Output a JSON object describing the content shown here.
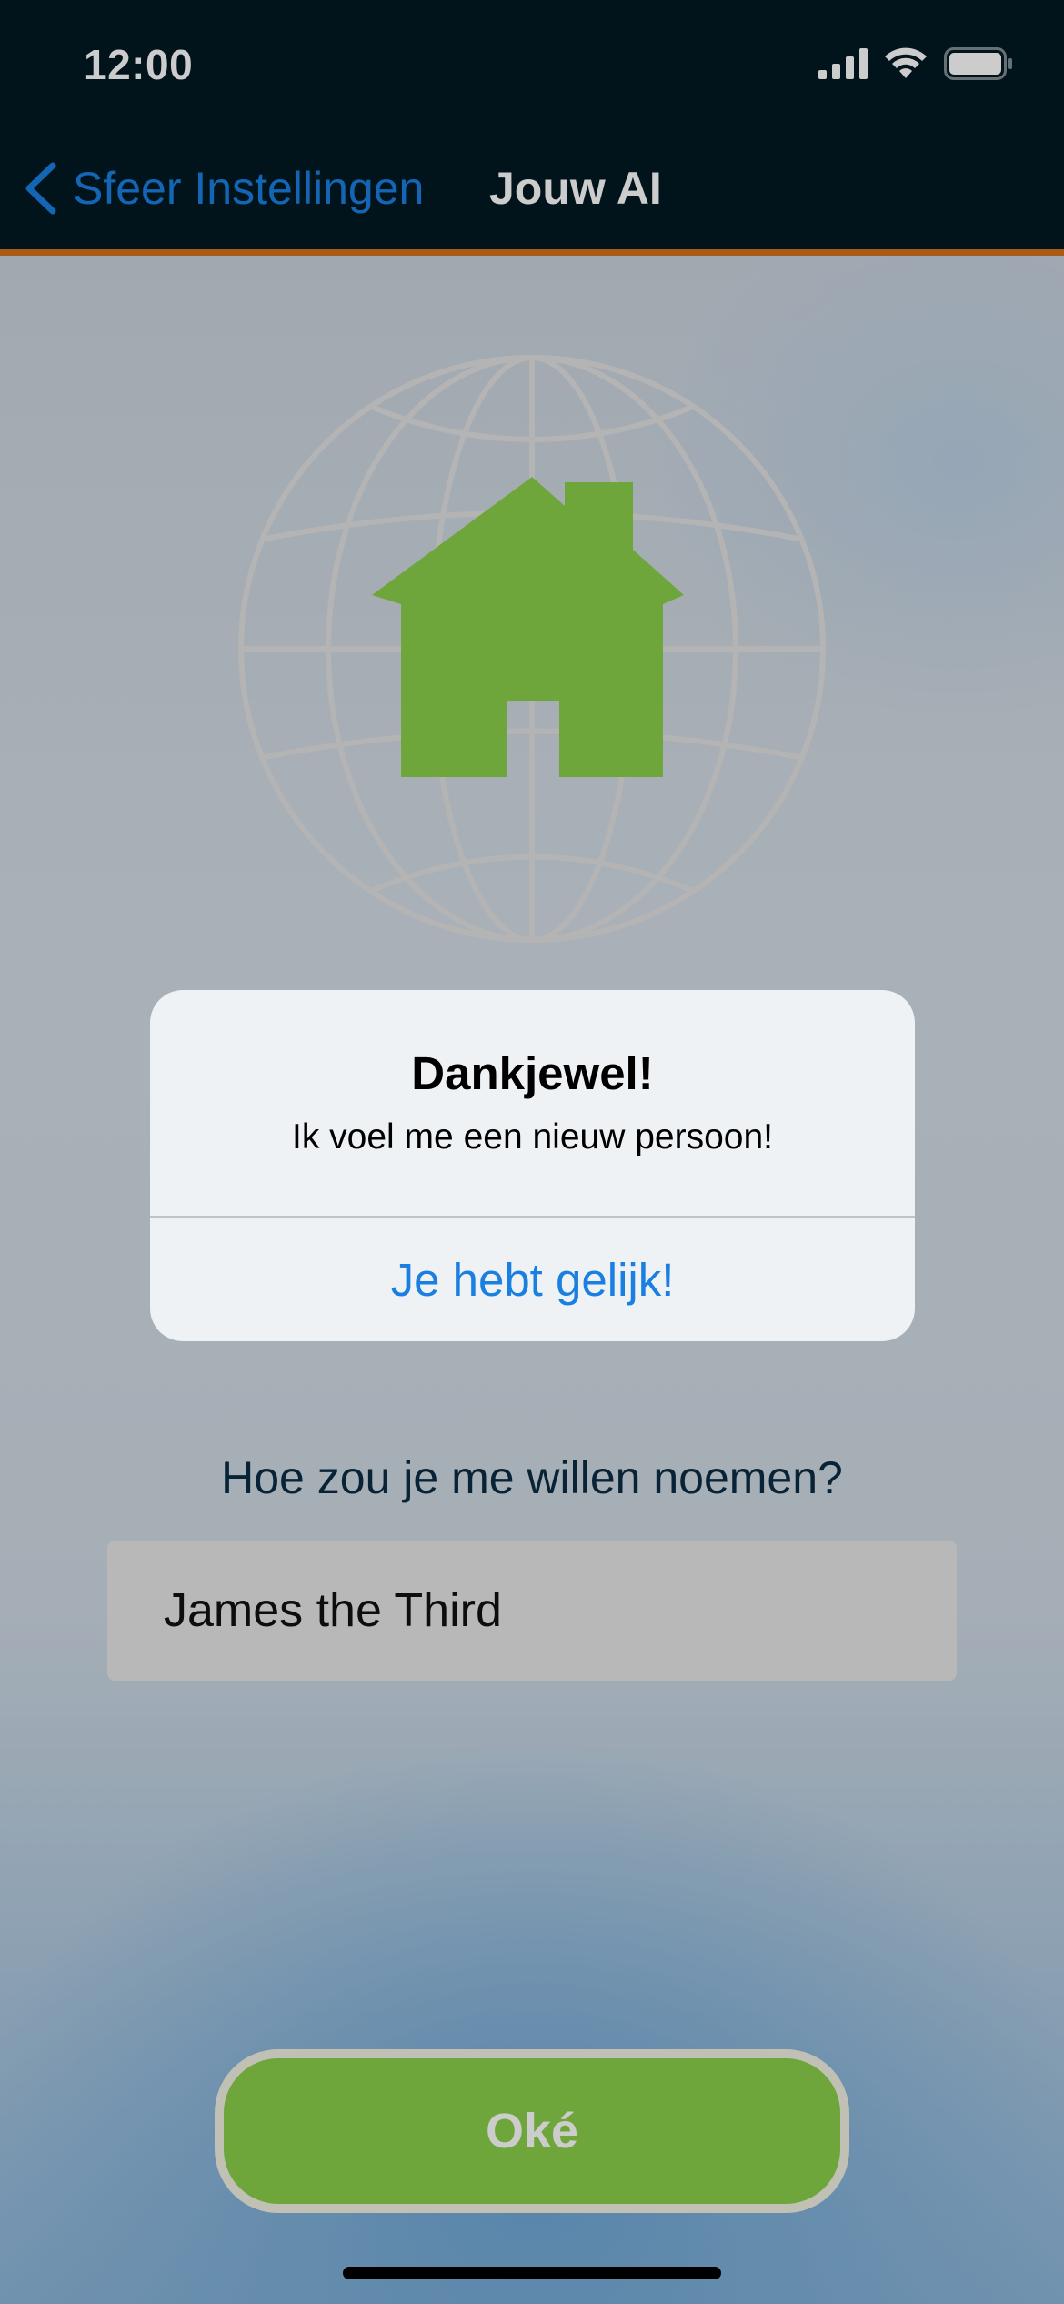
{
  "status_bar": {
    "time": "12:00"
  },
  "nav": {
    "back_label": "Sfeer Instellingen",
    "title": "Jouw AI"
  },
  "hero": {
    "icon": "house-globe-icon",
    "house_color": "#8bd04c",
    "globe_color": "#e0e0e0"
  },
  "form": {
    "prompt": "Hoe zou je me willen noemen?",
    "name_value": "James the Third"
  },
  "ok_button": {
    "label": "Oké"
  },
  "alert": {
    "title": "Dankjewel!",
    "message": "Ik voel me een nieuw persoon!",
    "action_label": "Je hebt gelijk!"
  },
  "colors": {
    "nav_background": "#021a24",
    "nav_accent": "#d2711c",
    "link_blue": "#1a7fe0",
    "button_green": "#8bd04c"
  }
}
